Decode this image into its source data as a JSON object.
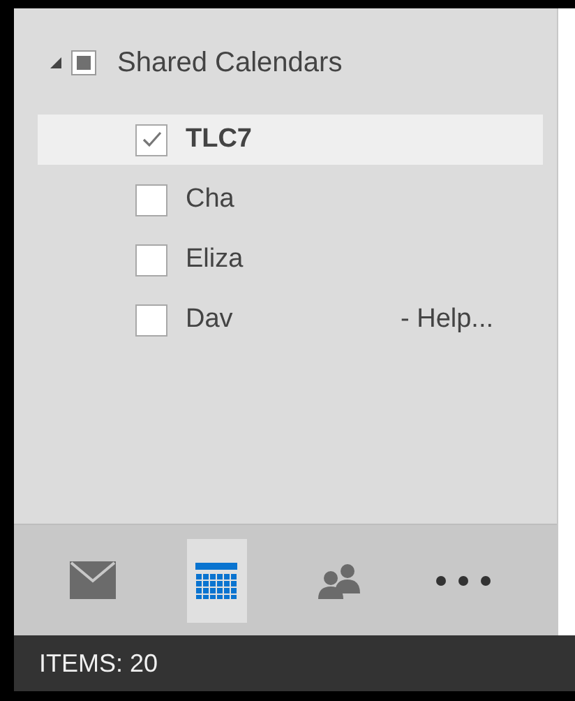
{
  "folder": {
    "label": "Shared Calendars",
    "expanded": true,
    "indeterminate": true
  },
  "calendars": [
    {
      "name": "TLC7",
      "checked": true,
      "selected": true
    },
    {
      "name": "Cha",
      "checked": false,
      "selected": false
    },
    {
      "name": "Eliza",
      "checked": false,
      "selected": false
    },
    {
      "name": "Dav",
      "note": "- Help...",
      "checked": false,
      "selected": false
    }
  ],
  "nav": [
    {
      "kind": "mail",
      "selected": false
    },
    {
      "kind": "calendar",
      "selected": true
    },
    {
      "kind": "people",
      "selected": false
    },
    {
      "kind": "more",
      "selected": false
    }
  ],
  "status_bar": "ITEMS: 20"
}
